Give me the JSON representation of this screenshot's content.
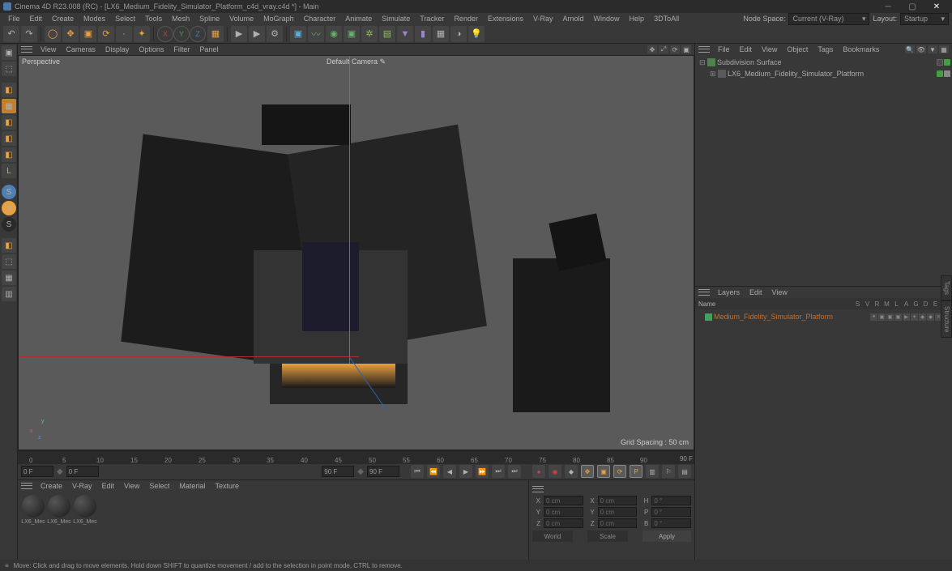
{
  "title": "Cinema 4D R23.008 (RC) - [LX6_Medium_Fidelity_Simulator_Platform_c4d_vray.c4d *] - Main",
  "menubar": [
    "File",
    "Edit",
    "Create",
    "Modes",
    "Select",
    "Tools",
    "Mesh",
    "Spline",
    "Volume",
    "MoGraph",
    "Character",
    "Animate",
    "Simulate",
    "Tracker",
    "Render",
    "Extensions",
    "V-Ray",
    "Arnold",
    "Window",
    "Help",
    "3DToAll"
  ],
  "node_space_label": "Node Space:",
  "node_space_value": "Current (V-Ray)",
  "layout_label": "Layout:",
  "layout_value": "Startup",
  "viewport": {
    "menu": [
      "View",
      "Cameras",
      "Display",
      "Options",
      "Filter",
      "Panel"
    ],
    "label": "Perspective",
    "camera": "Default Camera ",
    "grid_spacing": "Grid Spacing : 50 cm"
  },
  "timeline": {
    "ticks": [
      "0",
      "5",
      "10",
      "15",
      "20",
      "25",
      "30",
      "35",
      "40",
      "45",
      "50",
      "55",
      "60",
      "65",
      "70",
      "75",
      "80",
      "85",
      "90"
    ],
    "end": "90 F",
    "start_frame": "0 F",
    "cur_frame": "0 F",
    "range_start": "90 F",
    "range_end": "90 F"
  },
  "materials": {
    "menu": [
      "Create",
      "V-Ray",
      "Edit",
      "View",
      "Select",
      "Material",
      "Texture"
    ],
    "items": [
      "LX6_Mec",
      "LX6_Mec",
      "LX6_Mec"
    ]
  },
  "coords": {
    "x_pos": "0 cm",
    "y_pos": "0 cm",
    "z_pos": "0 cm",
    "x_size": "0 cm",
    "y_size": "0 cm",
    "z_size": "0 cm",
    "h": "0 °",
    "p": "0 °",
    "b": "0 °",
    "mode1": "World",
    "mode2": "Scale",
    "apply": "Apply",
    "labels": {
      "x": "X",
      "y": "Y",
      "z": "Z",
      "h": "H",
      "p": "P",
      "b": "B"
    }
  },
  "objects": {
    "menu": [
      "File",
      "Edit",
      "View",
      "Object",
      "Tags",
      "Bookmarks"
    ],
    "root": "Subdivision Surface",
    "child": "LX6_Medium_Fidelity_Simulator_Platform"
  },
  "layers": {
    "menu": [
      "Layers",
      "Edit",
      "View"
    ],
    "header_name": "Name",
    "letters": [
      "S",
      "V",
      "R",
      "M",
      "L",
      "A",
      "G",
      "D",
      "E",
      "X"
    ],
    "item": "Medium_Fidelity_Simulator_Platform"
  },
  "status": "Move: Click and drag to move elements. Hold down SHIFT to quantize movement / add to the selection in point mode, CTRL to remove.",
  "side_tabs": [
    "Tags",
    "Structure"
  ]
}
